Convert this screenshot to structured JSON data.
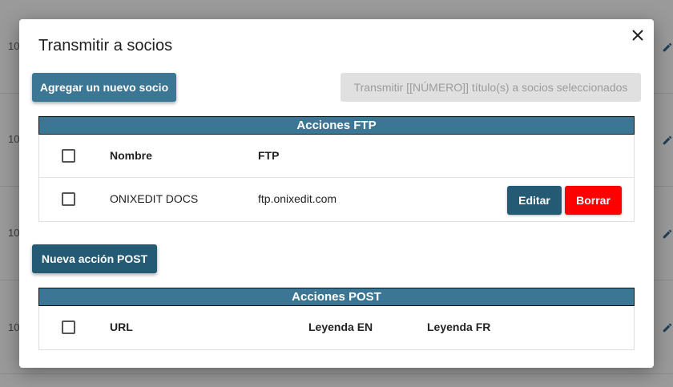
{
  "background": {
    "rows": [
      {
        "id_text": "10"
      },
      {
        "id_text": "10"
      },
      {
        "id_text": "10"
      },
      {
        "id_text": "10"
      }
    ]
  },
  "modal": {
    "title": "Transmitir a socios",
    "close_icon": "close-icon",
    "add_partner_label": "Agregar un nuevo socio",
    "transmit_label": "Transmitir [[NÚMERO]] título(s) a socios seleccionados",
    "new_post_label": "Nueva acción POST"
  },
  "ftp": {
    "section_title": "Acciones FTP",
    "headers": {
      "name": "Nombre",
      "ftp": "FTP"
    },
    "rows": [
      {
        "name": "ONIXEDIT DOCS",
        "ftp": "ftp.onixedit.com",
        "edit_label": "Editar",
        "delete_label": "Borrar"
      }
    ]
  },
  "post": {
    "section_title": "Acciones POST",
    "headers": {
      "url": "URL",
      "legend_en": "Leyenda EN",
      "legend_fr": "Leyenda FR"
    }
  },
  "colors": {
    "primary": "#3b7694",
    "primary_dark": "#245a74",
    "danger": "#ff0000",
    "disabled": "#e0e0e0"
  }
}
